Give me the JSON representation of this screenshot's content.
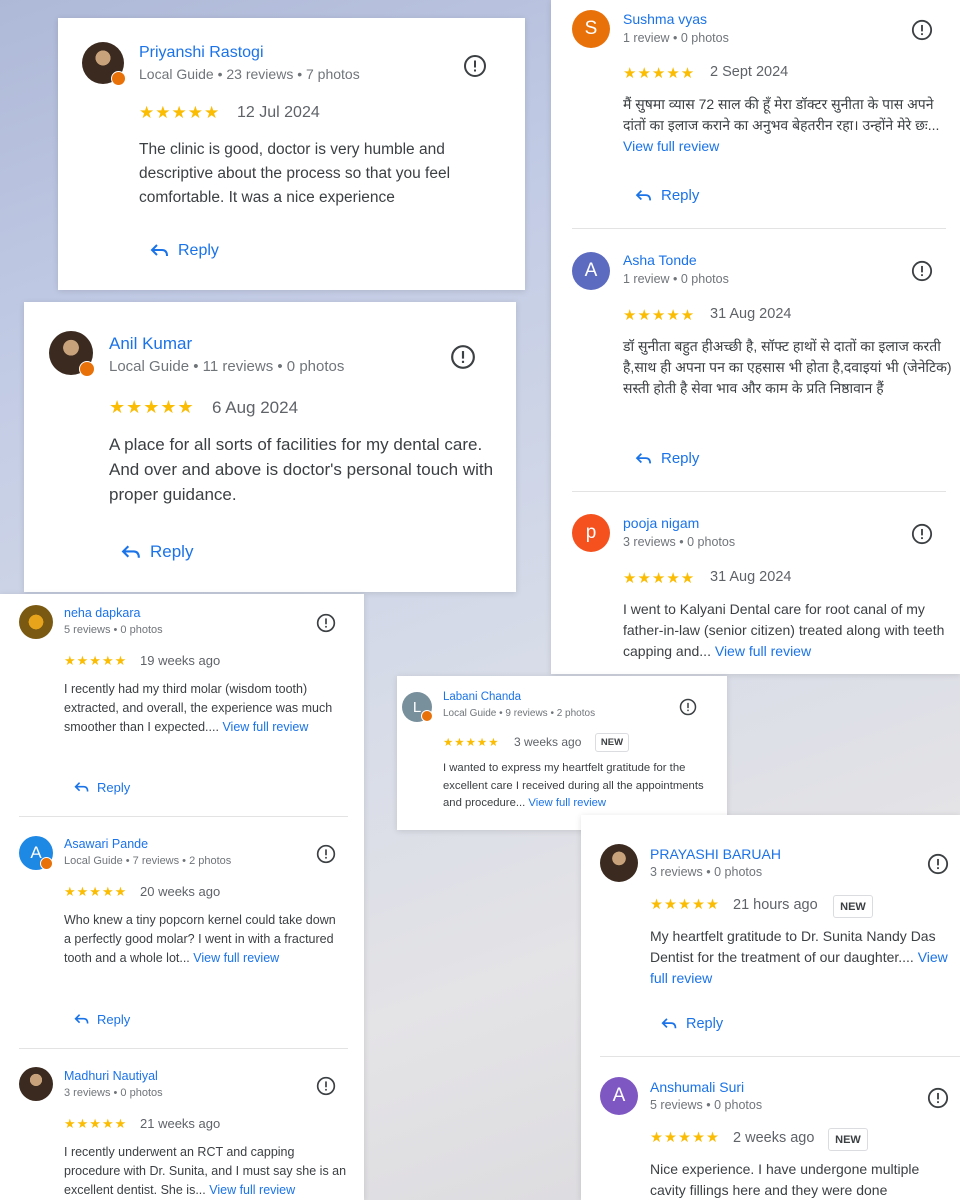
{
  "reply_label": "Reply",
  "view_full_review": "View full review",
  "new_badge": "NEW",
  "stars": "★★★★★",
  "colors": {
    "link": "#1a73e8",
    "star": "#fbbc04",
    "badge": "#e8710a"
  },
  "reviews": {
    "priyanshi": {
      "name": "Priyanshi Rastogi",
      "meta": "Local Guide • 23 reviews • 7 photos",
      "date": "12 Jul 2024",
      "text": "The clinic is good, doctor is very humble and descriptive about the process so that you feel comfortable. It was a nice experience"
    },
    "anil": {
      "name": "Anil Kumar",
      "meta": "Local Guide • 11 reviews • 0 photos",
      "date": "6 Aug 2024",
      "text": "A place for all sorts of facilities for my dental care. And over and above is doctor's personal touch with proper guidance."
    },
    "sushma": {
      "initial": "S",
      "name": "Sushma vyas",
      "meta": "1 review • 0 photos",
      "date": "2 Sept 2024",
      "text": "मैं सुषमा व्यास 72 साल की हूँ मेरा डॉक्टर सुनीता के पास अपने दांतों का इलाज कराने का अनुभव बेहतरीन रहा। उन्होंने मेरे छः..."
    },
    "asha": {
      "initial": "A",
      "name": "Asha Tonde",
      "meta": "1 review • 0 photos",
      "date": "31 Aug 2024",
      "text": "डॉ सुनीता बहुत हीअच्छी है, सॉफ्ट हाथों से दातों का इलाज करती है,साथ ही अपना पन का एहसास भी होता है,दवाइयां भी (जेनेटिक) सस्ती होती है सेवा भाव और काम के प्रति निष्ठावान हैं"
    },
    "pooja": {
      "initial": "p",
      "name": "pooja nigam",
      "meta": "3 reviews • 0 photos",
      "date": "31 Aug 2024",
      "text": "I went to Kalyani Dental care for root canal of my father-in-law (senior citizen) treated along with teeth capping and..."
    },
    "neha": {
      "name": "neha dapkara",
      "meta": "5 reviews • 0 photos",
      "date": "19 weeks ago",
      "text": "I recently had my third molar (wisdom tooth) extracted, and overall, the experience was much smoother than I expected...."
    },
    "asawari": {
      "initial": "A",
      "name": "Asawari Pande",
      "meta": "Local Guide • 7 reviews • 2 photos",
      "date": "20 weeks ago",
      "text": "Who knew a tiny popcorn kernel could take down a perfectly good molar? I went in with a fractured tooth and a whole lot..."
    },
    "madhuri": {
      "name": "Madhuri Nautiyal",
      "meta": "3 reviews • 0 photos",
      "date": "21 weeks ago",
      "text": "I recently underwent an RCT and capping procedure with Dr. Sunita, and I must say she is an excellent dentist. She is..."
    },
    "labani": {
      "initial": "L",
      "name": "Labani Chanda",
      "meta": "Local Guide • 9 reviews • 2 photos",
      "date": "3 weeks ago",
      "text": "I wanted to express my heartfelt gratitude for the excellent care I received during all the appointments and procedure..."
    },
    "prayashi": {
      "name": "PRAYASHI BARUAH",
      "meta": "3 reviews • 0 photos",
      "date": "21 hours ago",
      "text": "My heartfelt gratitude to Dr. Sunita Nandy Das Dentist for the treatment of our daughter...."
    },
    "anshumali": {
      "initial": "A",
      "name": "Anshumali Suri",
      "meta": "5 reviews • 0 photos",
      "date": "2 weeks ago",
      "text": "Nice experience. I have undergone multiple cavity fillings here and they were done"
    }
  }
}
